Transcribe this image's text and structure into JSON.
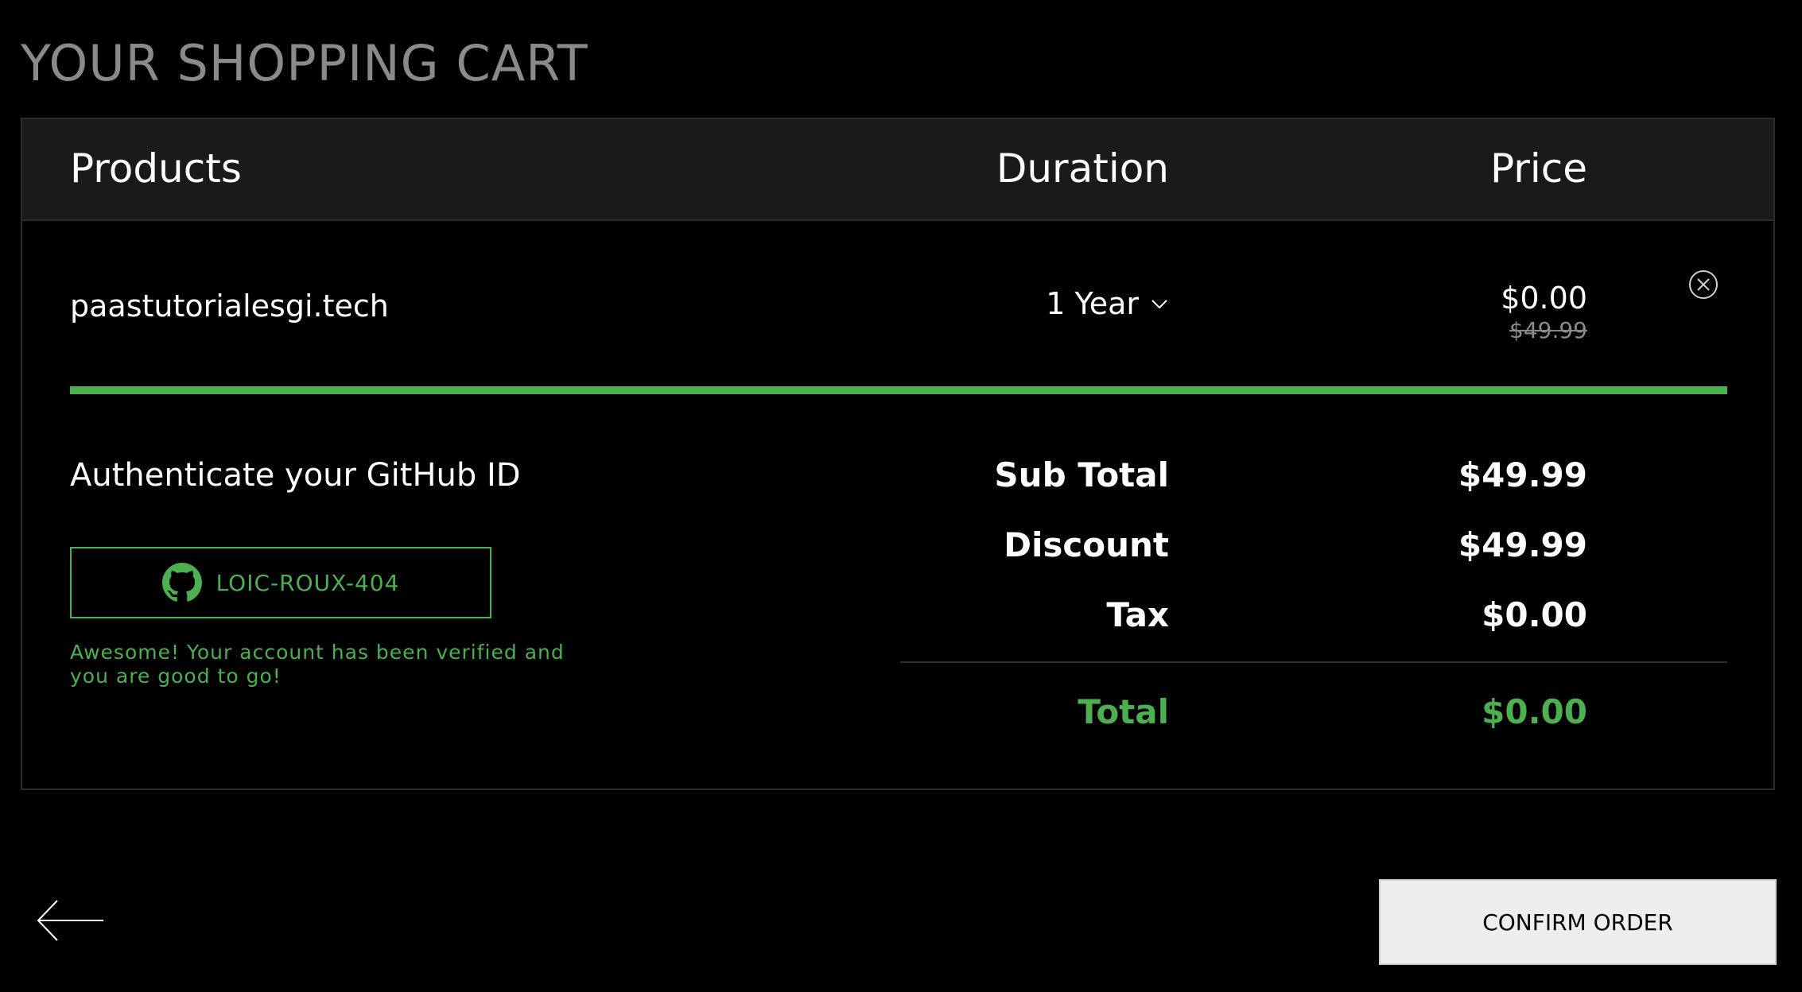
{
  "page": {
    "title": "YOUR SHOPPING CART"
  },
  "cart": {
    "headers": {
      "products": "Products",
      "duration": "Duration",
      "price": "Price"
    },
    "items": [
      {
        "name": "paastutorialesgi.tech",
        "duration": "1 Year",
        "price": "$0.00",
        "original_price": "$49.99"
      }
    ],
    "progress_percent": 100
  },
  "auth": {
    "title": "Authenticate your GitHub ID",
    "github_username": "LOIC-ROUX-404",
    "verified_message": "Awesome! Your account has been verified and you are good to go!"
  },
  "summary": {
    "subtotal_label": "Sub Total",
    "subtotal_value": "$49.99",
    "discount_label": "Discount",
    "discount_value": "$49.99",
    "tax_label": "Tax",
    "tax_value": "$0.00",
    "total_label": "Total",
    "total_value": "$0.00"
  },
  "actions": {
    "confirm_label": "CONFIRM ORDER"
  },
  "icons": {
    "back": "arrow-left-icon",
    "remove": "close-circle-icon",
    "dropdown": "chevron-down-icon",
    "github": "github-icon"
  },
  "colors": {
    "background": "#000000",
    "panel_header": "#1a1a1a",
    "accent": "#4caf50",
    "title": "#8a8a8a",
    "button_bg": "#eeeeee"
  }
}
